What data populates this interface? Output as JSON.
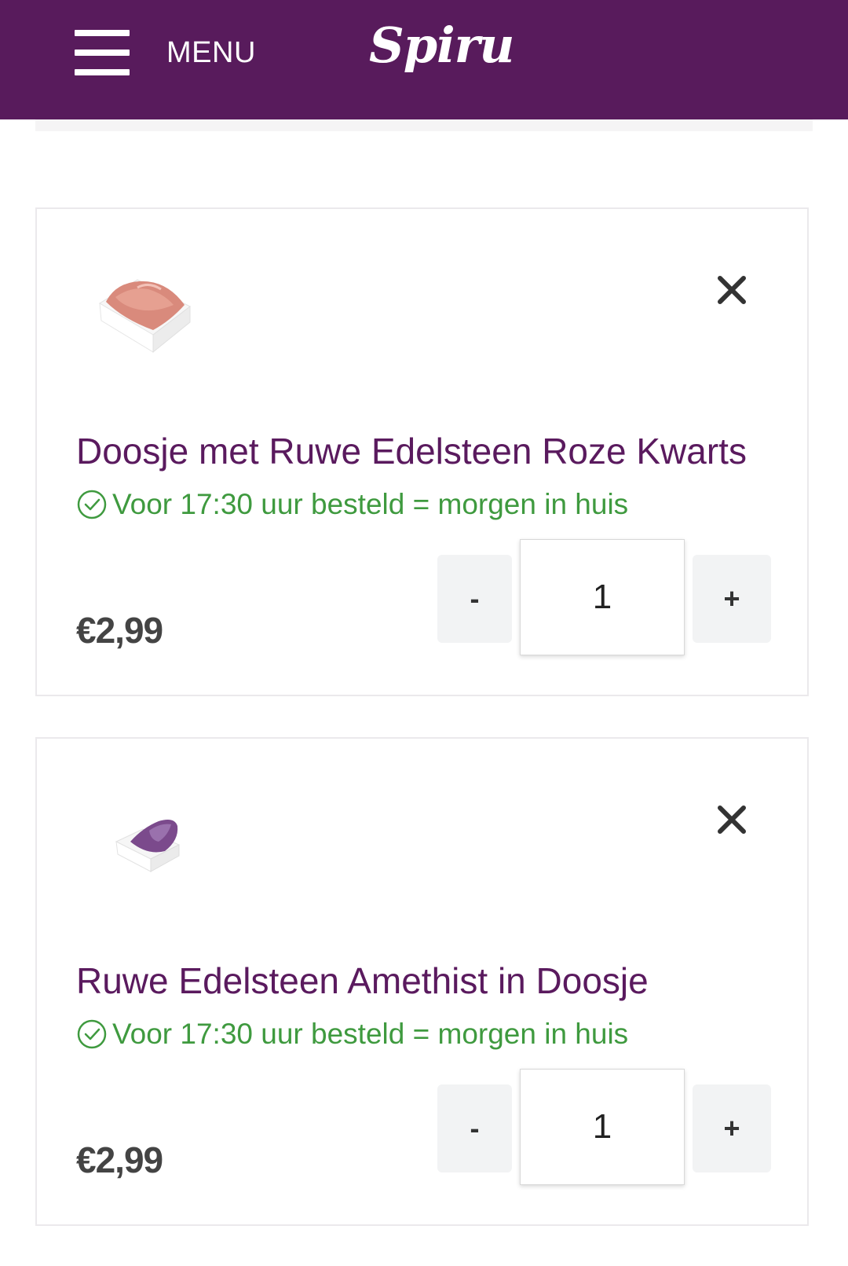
{
  "header": {
    "menu_label": "MENU",
    "brand": "Spiru",
    "background_color": "#581b5c"
  },
  "cart": {
    "items": [
      {
        "title": "Doosje met Ruwe Edelsteen Roze Kwarts",
        "delivery_note": "Voor 17:30 uur besteld = morgen in huis",
        "price": "€2,99",
        "quantity": "1",
        "decrement_label": "-",
        "increment_label": "+",
        "image_icon": "rose-quartz-box-image",
        "remove_icon": "close-icon"
      },
      {
        "title": "Ruwe Edelsteen Amethist in Doosje",
        "delivery_note": "Voor 17:30 uur besteld = morgen in huis",
        "price": "€2,99",
        "quantity": "1",
        "decrement_label": "-",
        "increment_label": "+",
        "image_icon": "amethyst-box-image",
        "remove_icon": "close-icon"
      }
    ]
  },
  "colors": {
    "title": "#5a1a5e",
    "delivery": "#3f9a3f",
    "price": "#444444"
  }
}
